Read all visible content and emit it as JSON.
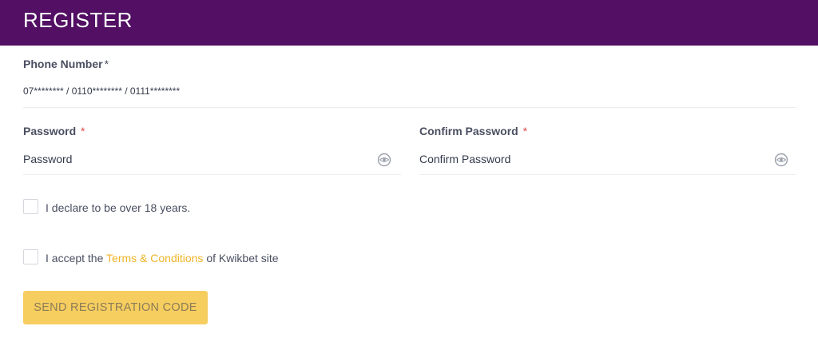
{
  "header": {
    "title": "REGISTER"
  },
  "phone": {
    "label": "Phone Number",
    "required_mark": "*",
    "placeholder": "07******** / 0110******** / 0111********"
  },
  "password": {
    "label": "Password",
    "required_mark": "*",
    "placeholder": "Password",
    "icon": "eye-icon"
  },
  "confirm_password": {
    "label": "Confirm Password",
    "required_mark": "*",
    "placeholder": "Confirm Password",
    "icon": "eye-icon"
  },
  "age_declaration": {
    "text": "I declare to be over 18 years."
  },
  "terms": {
    "prefix": "I accept the",
    "link": "Terms & Conditions",
    "suffix": "of Kwikbet site"
  },
  "submit": {
    "label": "SEND REGISTRATION CODE"
  },
  "colors": {
    "header_bg": "#520f63",
    "accent": "#f0b429",
    "button_bg": "#f6cd5f",
    "required": "#e24a4a"
  }
}
